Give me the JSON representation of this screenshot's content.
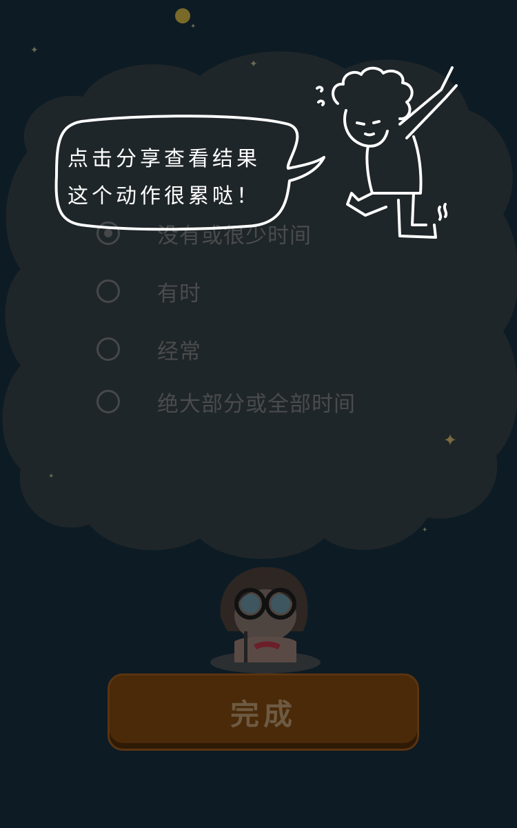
{
  "hint": {
    "text": "点击分享查看结果\n这个动作很累哒！"
  },
  "options": [
    {
      "label": "没有或很少时间",
      "checked": true
    },
    {
      "label": "有时",
      "checked": false
    },
    {
      "label": "经常",
      "checked": false
    },
    {
      "label": "绝大部分或全部时间",
      "checked": false
    }
  ],
  "done_button": {
    "label": "完成"
  },
  "colors": {
    "background": "#0d1b24",
    "cloud": "#1f2629",
    "button": "#4a2a08",
    "hint_text": "#ffffff"
  },
  "icons": {
    "moon": "moon-icon",
    "star": "star-icon",
    "pointing_character": "pointing-boy-illustration",
    "writing_girl": "writing-girl-illustration"
  }
}
